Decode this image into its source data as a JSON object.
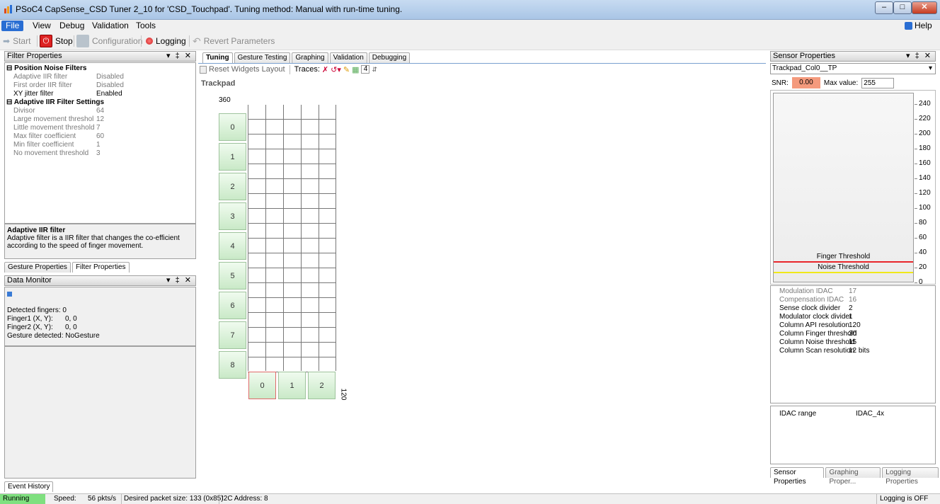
{
  "window": {
    "title": "PSoC4 CapSense_CSD Tuner 2_10 for 'CSD_Touchpad'. Tuning method: Manual with run-time tuning."
  },
  "menu": {
    "items": [
      "File",
      "View",
      "Debug",
      "Validation",
      "Tools"
    ],
    "help": "Help"
  },
  "toolbar": {
    "start": "Start",
    "stop": "Stop",
    "configuration": "Configuration",
    "logging": "Logging",
    "revert": "Revert Parameters"
  },
  "filter_panel": {
    "title": "Filter Properties",
    "cat1": "Position Noise Filters",
    "rows1": [
      {
        "k": "Adaptive IIR filter",
        "v": "Disabled",
        "grey": true
      },
      {
        "k": "First order IIR filter",
        "v": "Disabled",
        "grey": true
      },
      {
        "k": "XY jitter filter",
        "v": "Enabled",
        "grey": false
      }
    ],
    "cat2": "Adaptive IIR Filter Settings",
    "rows2": [
      {
        "k": "Divisor",
        "v": "64"
      },
      {
        "k": "Large movement threshol",
        "v": "12"
      },
      {
        "k": "Little movement threshold",
        "v": "7"
      },
      {
        "k": "Max filter coefficient",
        "v": "60"
      },
      {
        "k": "Min filter coefficient",
        "v": "1"
      },
      {
        "k": "No movement threshold",
        "v": "3"
      }
    ],
    "desc_title": "Adaptive IIR filter",
    "desc_line1": "Adaptive filter is a IIR filter that changes the co-efficient",
    "desc_line2": "according to the speed of finger movement."
  },
  "left_tabs": [
    "Gesture Properties",
    "Filter Properties"
  ],
  "data_monitor": {
    "title": "Data Monitor",
    "detected": "Detected fingers:  0",
    "finger1_label": "Finger1 (X, Y):",
    "finger1_val": "0, 0",
    "finger2_label": "Finger2 (X, Y):",
    "finger2_val": "0, 0",
    "gesture": "Gesture detected:  NoGesture"
  },
  "event_tab": "Event History",
  "main_tabs": [
    "Tuning",
    "Gesture Testing",
    "Graphing",
    "Validation",
    "Debugging"
  ],
  "subtoolbar": {
    "reset": "Reset Widgets Layout",
    "traces": "Traces:",
    "trace_count": "4"
  },
  "trackpad": {
    "label": "Trackpad",
    "y_max": "360",
    "x_max": "120",
    "rows": [
      "0",
      "1",
      "2",
      "3",
      "4",
      "5",
      "6",
      "7",
      "8"
    ],
    "cols": [
      "0",
      "1",
      "2"
    ]
  },
  "sensor_panel": {
    "title": "Sensor Properties",
    "selected": "Trackpad_Col0__TP",
    "snr_label": "SNR:",
    "snr_value": "0.00",
    "max_label": "Max value:",
    "max_value": "255",
    "y_ticks": [
      "240",
      "220",
      "200",
      "180",
      "160",
      "140",
      "120",
      "100",
      "80",
      "60",
      "40",
      "20",
      "0"
    ],
    "finger_threshold_label": "Finger Threshold",
    "noise_threshold_label": "Noise Threshold",
    "finger_threshold": 30,
    "noise_threshold": 15,
    "finger_color": "#e8262b",
    "noise_color": "#f0e81a",
    "props": [
      {
        "k": "Modulation IDAC",
        "v": "17",
        "grey": true
      },
      {
        "k": "Compensation IDAC",
        "v": "16",
        "grey": true
      },
      {
        "k": "Sense clock divider",
        "v": "2",
        "grey": false
      },
      {
        "k": "Modulator clock divider",
        "v": "1",
        "grey": false
      },
      {
        "k": "Column API resolution",
        "v": "120",
        "grey": false
      },
      {
        "k": "Column Finger threshold",
        "v": "30",
        "grey": false
      },
      {
        "k": "Column Noise threshold",
        "v": "15",
        "grey": false
      },
      {
        "k": "Column Scan resolution",
        "v": "12 bits",
        "grey": false
      }
    ],
    "idac_label": "IDAC range",
    "idac_value": "IDAC_4x",
    "bottom_tabs": [
      "Sensor Properties",
      "Graphing Proper...",
      "Logging Properties"
    ]
  },
  "status": {
    "running": "Running",
    "speed_label": "Speed:",
    "speed": "56 pkts/s",
    "packet": "Desired packet size:  133 (0x85)",
    "i2c": "I2C Address: 8",
    "logging": "Logging is OFF"
  }
}
